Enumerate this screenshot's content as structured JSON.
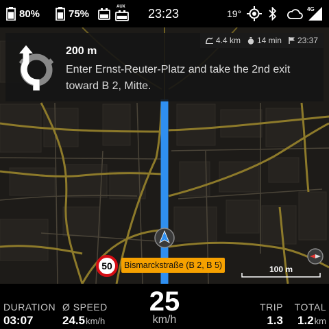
{
  "status_bar": {
    "battery_1": {
      "percent": "80%",
      "level": 0.8
    },
    "battery_2": {
      "percent": "75%",
      "level": 0.75
    },
    "aux_label": "AUX",
    "time": "23:23",
    "temperature": "19°",
    "network_type": "4G",
    "icons": [
      "battery-icon",
      "battery-icon",
      "device-icon",
      "aux-icon",
      "gps-icon",
      "bluetooth-icon",
      "cloud-icon",
      "signal-icon"
    ]
  },
  "instruction_card": {
    "maneuver_icon": "roundabout-second-exit-icon",
    "distance": "200 m",
    "instruction": "Enter Ernst-Reuter-Platz and take the 2nd exit toward B 2, Mitte.",
    "trip_summary": {
      "remaining_distance": "4.4 km",
      "remaining_time": "14 min",
      "arrival_time": "23:37"
    }
  },
  "map": {
    "speed_limit": "50",
    "street_name": "Bismarckstraße (B 2, B 5)",
    "scale": "100 m",
    "colors": {
      "background": "#1d1b18",
      "route": "#2f8ff0",
      "major_road": "#8d7a2a",
      "street_label": "#f6a100",
      "speed_limit_ring": "#d50d14"
    }
  },
  "bottom_bar": {
    "duration": {
      "label": "DURATION",
      "value": "03:07"
    },
    "avg_speed": {
      "label": "Ø SPEED",
      "value": "24.5",
      "unit": "km/h"
    },
    "current_speed": {
      "value": "25",
      "unit": "km/h"
    },
    "trip": {
      "label": "TRIP",
      "value": "1.3"
    },
    "total": {
      "label": "TOTAL",
      "value": "1.2",
      "unit": "km"
    }
  }
}
